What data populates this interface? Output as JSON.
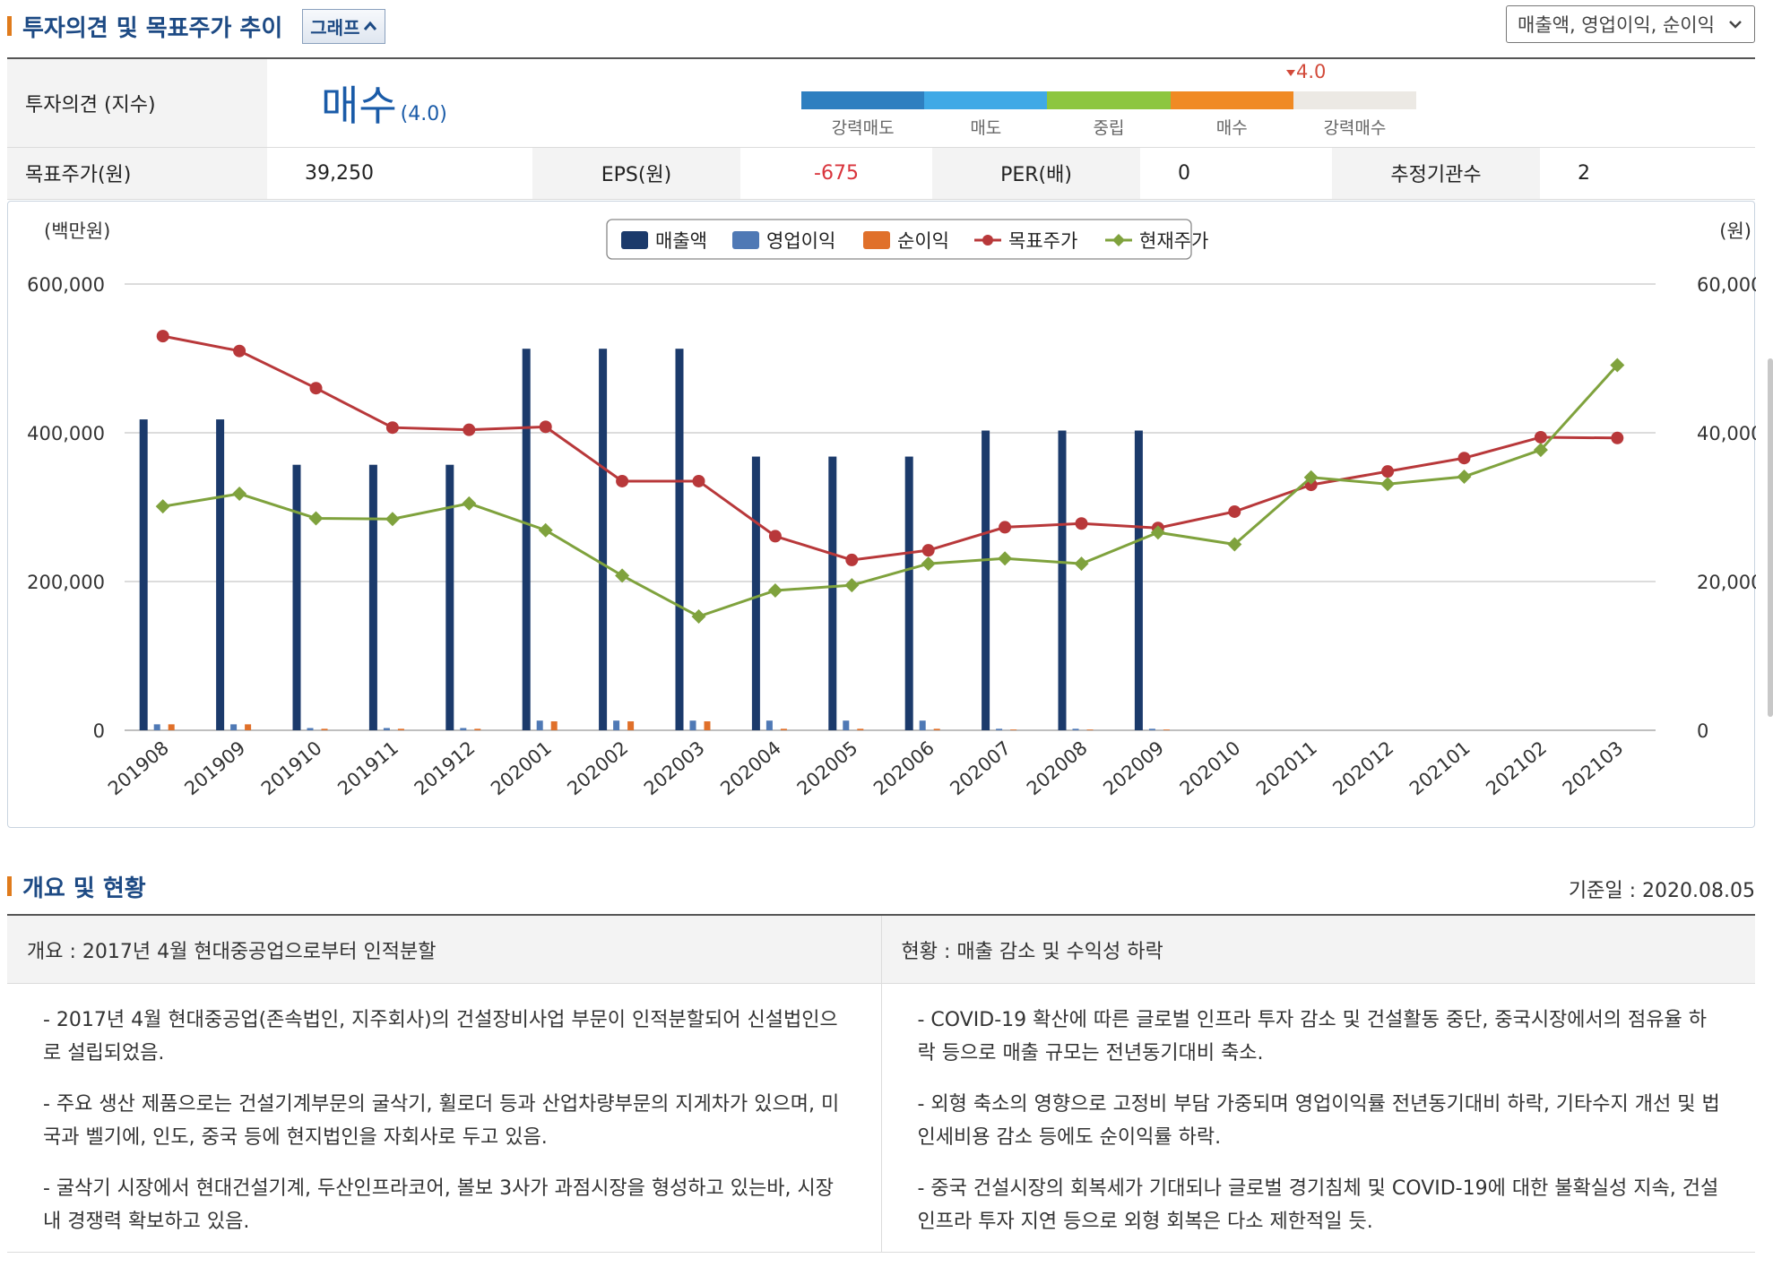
{
  "header": {
    "title": "투자의견 및 목표주가 추이",
    "graph_button": "그래프"
  },
  "select": {
    "value": "매출액, 영업이익, 순이익"
  },
  "opinion": {
    "label": "투자의견 (지수)",
    "value": "매수",
    "score": "(4.0)",
    "marker": "4.0",
    "scale": [
      {
        "label": "강력매도",
        "color": "#2e7fc0"
      },
      {
        "label": "매도",
        "color": "#3fa9e6"
      },
      {
        "label": "중립",
        "color": "#8dc63f"
      },
      {
        "label": "매수",
        "color": "#f08a24"
      },
      {
        "label": "강력매수",
        "color": "#ece9e4"
      }
    ]
  },
  "metrics": {
    "target_label": "목표주가(원)",
    "target_value": "39,250",
    "eps_label": "EPS(원)",
    "eps_value": "-675",
    "per_label": "PER(배)",
    "per_value": "0",
    "inst_label": "추정기관수",
    "inst_value": "2"
  },
  "colors": {
    "negative": "#d9343c",
    "accent": "#1d4a84",
    "section_bar": "#e07b1c"
  },
  "chart_data": {
    "type": "bar",
    "left_unit": "(백만원)",
    "right_unit": "(원)",
    "ylim_left": [
      0,
      600000
    ],
    "ylim_right": [
      0,
      60000
    ],
    "left_ticks": [
      "600,000",
      "400,000",
      "200,000",
      "0"
    ],
    "right_ticks": [
      "60,000",
      "40,000",
      "20,000",
      "0"
    ],
    "grid": true,
    "legend_position": "top-center",
    "categories": [
      "201908",
      "201909",
      "201910",
      "201911",
      "201912",
      "202001",
      "202002",
      "202003",
      "202004",
      "202005",
      "202006",
      "202007",
      "202008",
      "202009",
      "202010",
      "202011",
      "202012",
      "202101",
      "202102",
      "202103"
    ],
    "series": [
      {
        "name": "매출액",
        "kind": "bar",
        "axis": "left",
        "color": "#1b3a6b",
        "values": [
          418000,
          418000,
          357000,
          357000,
          357000,
          513000,
          513000,
          513000,
          368000,
          368000,
          368000,
          403000,
          403000,
          403000,
          null,
          null,
          null,
          null,
          null,
          null
        ]
      },
      {
        "name": "영업이익",
        "kind": "bar",
        "axis": "left",
        "color": "#4f79b5",
        "values": [
          8000,
          8000,
          3000,
          3000,
          3000,
          13000,
          13000,
          13000,
          13000,
          13000,
          13000,
          2000,
          2000,
          2000,
          null,
          null,
          null,
          null,
          null,
          null
        ]
      },
      {
        "name": "순이익",
        "kind": "bar",
        "axis": "left",
        "color": "#e0702a",
        "values": [
          8000,
          8000,
          2000,
          2000,
          2000,
          12000,
          12000,
          12000,
          2000,
          2000,
          2000,
          1000,
          1000,
          1000,
          null,
          null,
          null,
          null,
          null,
          null
        ]
      },
      {
        "name": "목표주가",
        "kind": "line",
        "axis": "right",
        "color": "#b8383a",
        "marker": "circle",
        "values": [
          53000,
          51000,
          46000,
          40700,
          40400,
          40800,
          33500,
          33500,
          26100,
          22900,
          24200,
          27300,
          27800,
          27200,
          29400,
          33000,
          34800,
          36600,
          39400,
          39300
        ]
      },
      {
        "name": "현재주가",
        "kind": "line",
        "axis": "right",
        "color": "#7fa23d",
        "marker": "diamond",
        "values": [
          30100,
          31800,
          28500,
          28400,
          30500,
          26900,
          20800,
          15300,
          18800,
          19500,
          22400,
          23100,
          22400,
          26600,
          25000,
          34000,
          33100,
          34100,
          37700,
          49100
        ]
      }
    ]
  },
  "overview": {
    "title": "개요 및 현황",
    "base_date": "기준일 : 2020.08.05",
    "summary_head": "개요 : 2017년 4월 현대중공업으로부터 인적분할",
    "status_head": "현황 : 매출 감소 및 수익성 하락",
    "summary_items": [
      "- 2017년 4월 현대중공업(존속법인, 지주회사)의 건설장비사업 부문이 인적분할되어 신설법인으로 설립되었음.",
      "- 주요 생산 제품으로는 건설기계부문의 굴삭기, 휠로더 등과 산업차량부문의 지게차가 있으며, 미국과 벨기에, 인도, 중국 등에 현지법인을 자회사로 두고 있음.",
      "- 굴삭기 시장에서 현대건설기계, 두산인프라코어, 볼보 3사가 과점시장을 형성하고 있는바, 시장 내 경쟁력 확보하고 있음."
    ],
    "status_items": [
      "- COVID-19 확산에 따른 글로벌 인프라 투자 감소 및 건설활동 중단, 중국시장에서의 점유율 하락 등으로 매출 규모는 전년동기대비 축소.",
      "- 외형 축소의 영향으로 고정비 부담 가중되며 영업이익률 전년동기대비 하락, 기타수지 개선 및 법인세비용 감소 등에도 순이익률 하락.",
      "- 중국 건설시장의 회복세가 기대되나 글로벌 경기침체 및 COVID-19에 대한 불확실성 지속, 건설 인프라 투자 지연 등으로 외형 회복은 다소 제한적일 듯."
    ]
  }
}
